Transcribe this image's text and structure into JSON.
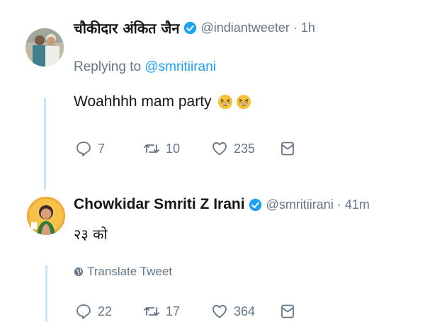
{
  "tweets": [
    {
      "display_name": "चौकीदार अंकित जैन",
      "handle": "@indiantweeter",
      "separator": "·",
      "time": "1h",
      "replying_label": "Replying to",
      "replying_to": "@smritiirani",
      "text": "Woahhhh mam party",
      "emojis": [
        "grinning-squinting-face",
        "grinning-squinting-face"
      ],
      "reply_count": "7",
      "retweet_count": "10",
      "like_count": "235"
    },
    {
      "display_name": "Chowkidar Smriti Z Irani",
      "handle": "@smritiirani",
      "separator": "·",
      "time": "41m",
      "text": "२३ को",
      "translate_label": "Translate Tweet",
      "reply_count": "22",
      "retweet_count": "17",
      "like_count": "364"
    }
  ],
  "colors": {
    "link": "#1da1f2",
    "muted": "#657786",
    "thread_line": "#c9e2f5"
  },
  "icons": [
    "verified-badge-icon",
    "reply-icon",
    "retweet-icon",
    "like-icon",
    "direct-message-icon",
    "globe-icon"
  ]
}
